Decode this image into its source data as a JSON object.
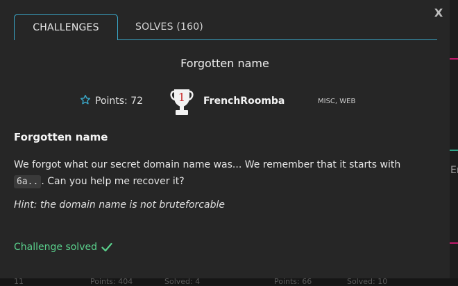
{
  "modal": {
    "close_label": "X",
    "tabs": [
      {
        "label": "CHALLENGES",
        "active": true
      },
      {
        "label": "SOLVES (160)",
        "active": false
      }
    ]
  },
  "challenge": {
    "title": "Forgotten name",
    "points_label": "Points: 72",
    "author_rank": "1",
    "author": "FrenchRoomba",
    "categories": "MISC, WEB",
    "heading": "Forgotten name",
    "description_before": "We forgot what our secret domain name was... We remember that it starts with ",
    "description_code": "6a..",
    "description_after": ". Can you help me recover it?",
    "hint": "Hint: the domain name is not bruteforcable",
    "status": "Challenge solved"
  },
  "background": {
    "row_fragments": [
      "11",
      "Points: 404",
      "Solved: 4",
      "Points: 66",
      "Solved: 10"
    ],
    "right_fragment": "Er"
  },
  "colors": {
    "accent": "#3aa7c8",
    "success": "#5ad08c",
    "modal_bg": "#262626"
  },
  "icons": {
    "points": "star-outline-icon",
    "author": "trophy-icon",
    "status": "checkmark-icon"
  }
}
